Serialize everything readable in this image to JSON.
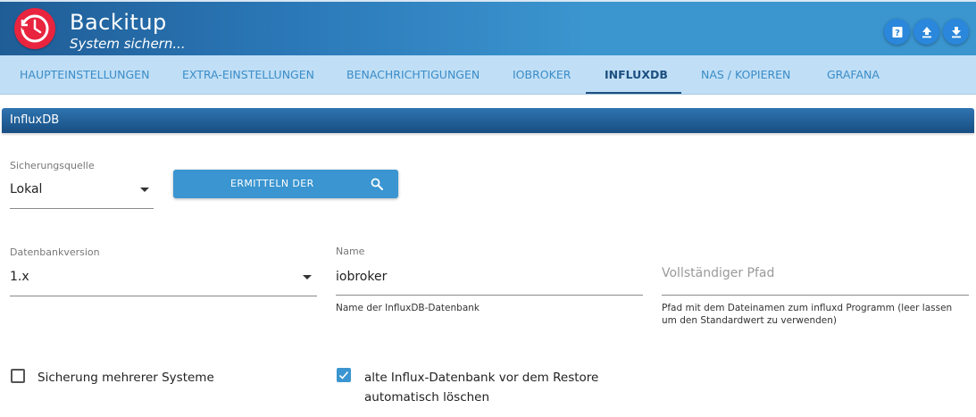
{
  "app": {
    "title": "Backitup",
    "subtitle": "System sichern..."
  },
  "header_buttons": [
    {
      "icon": "help-icon"
    },
    {
      "icon": "upload-icon"
    },
    {
      "icon": "download-icon"
    }
  ],
  "tabs": [
    {
      "label": "HAUPTEINSTELLUNGEN",
      "active": false
    },
    {
      "label": "EXTRA-EINSTELLUNGEN",
      "active": false
    },
    {
      "label": "BENACHRICHTIGUNGEN",
      "active": false
    },
    {
      "label": "IOBROKER",
      "active": false
    },
    {
      "label": "INFLUXDB",
      "active": true
    },
    {
      "label": "NAS / KOPIEREN",
      "active": false
    },
    {
      "label": "GRAFANA",
      "active": false
    }
  ],
  "section": {
    "title": "InfluxDB"
  },
  "source": {
    "label": "Sicherungsquelle",
    "value": "Lokal"
  },
  "detect_button": {
    "label": "ERMITTELN DER",
    "icon": "search-icon"
  },
  "db_version": {
    "label": "Datenbankversion",
    "value": "1.x"
  },
  "db_name": {
    "label": "Name",
    "value": "iobroker",
    "helper": "Name der InfluxDB-Datenbank"
  },
  "full_path": {
    "placeholder": "Vollständiger Pfad",
    "helper_line1": "Pfad mit dem Dateinamen zum influxd Programm (leer lassen",
    "helper_line2": "um den Standardwert zu verwenden)"
  },
  "multi_system": {
    "label": "Sicherung mehrerer Systeme",
    "checked": false
  },
  "delete_old": {
    "label_line1": "alte Influx-Datenbank vor dem Restore",
    "label_line2": "automatisch löschen",
    "checked": true
  },
  "colors": {
    "accent": "#3a95d0",
    "header": "#3b95cf",
    "tab_bar": "#c0dff6",
    "section": "#1f5d96",
    "logo": "#e8243f"
  }
}
